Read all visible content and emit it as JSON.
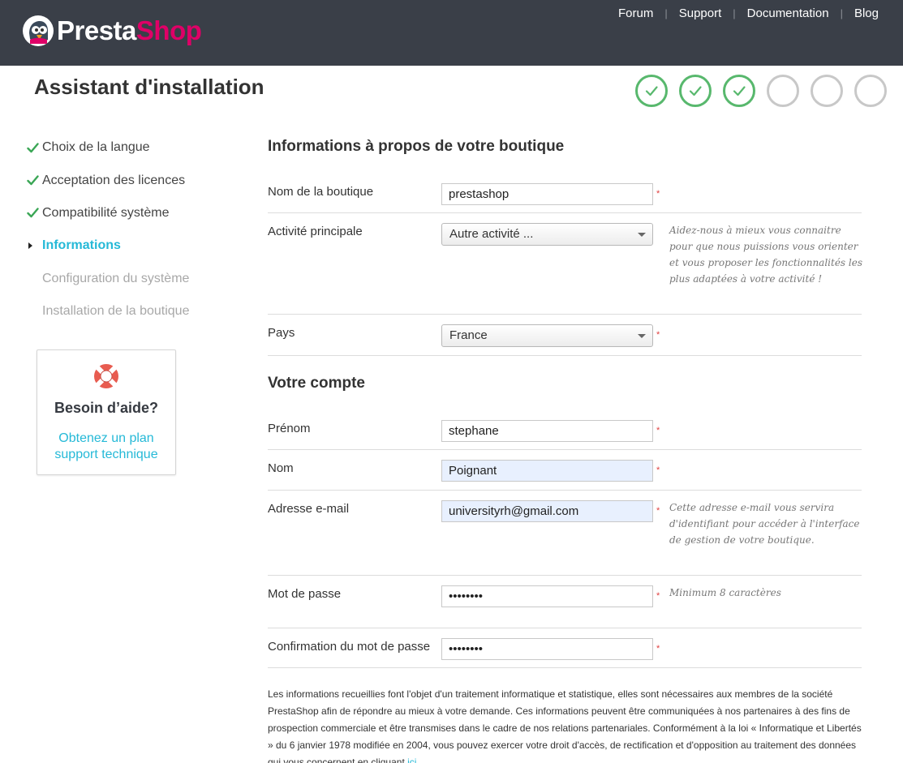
{
  "header": {
    "logo_part1": "Presta",
    "logo_part2": "Shop",
    "nav": [
      "Forum",
      "Support",
      "Documentation",
      "Blog"
    ]
  },
  "title": "Assistant d'installation",
  "steps": [
    {
      "state": "done"
    },
    {
      "state": "done"
    },
    {
      "state": "done"
    },
    {
      "state": "todo"
    },
    {
      "state": "todo"
    },
    {
      "state": "todo"
    }
  ],
  "sidebar": {
    "items": [
      {
        "label": "Choix de la langue",
        "state": "done"
      },
      {
        "label": "Acceptation des licences",
        "state": "done"
      },
      {
        "label": "Compatibilité système",
        "state": "done"
      },
      {
        "label": "Informations",
        "state": "active"
      },
      {
        "label": "Configuration du système",
        "state": "todo"
      },
      {
        "label": "Installation de la boutique",
        "state": "todo"
      }
    ]
  },
  "help": {
    "title": "Besoin d’aide?",
    "link_line1": "Obtenez un plan",
    "link_line2": "support technique"
  },
  "shop_section": {
    "title": "Informations à propos de votre boutique",
    "shop_name": {
      "label": "Nom de la boutique",
      "value": "prestashop"
    },
    "activity": {
      "label": "Activité principale",
      "value": "Autre activité ...",
      "hint": "Aidez-nous à mieux vous connaitre pour que nous puissions vous orienter et vous proposer les fonctionnalités les plus adaptées à votre activité !"
    },
    "country": {
      "label": "Pays",
      "value": "France"
    }
  },
  "account_section": {
    "title": "Votre compte",
    "firstname": {
      "label": "Prénom",
      "value": "stephane"
    },
    "lastname": {
      "label": "Nom",
      "value": "Poignant"
    },
    "email": {
      "label": "Adresse e-mail",
      "value": "universityrh@gmail.com",
      "hint": "Cette adresse e-mail vous servira d'identifiant pour accéder à l'interface de gestion de votre boutique."
    },
    "password": {
      "label": "Mot de passe",
      "value": "••••••••",
      "hint": "Minimum 8 caractères"
    },
    "password_confirm": {
      "label": "Confirmation du mot de passe",
      "value": "••••••••"
    }
  },
  "required_mark": "*",
  "legal": {
    "text": "Les informations recueillies font l'objet d'un traitement informatique et statistique, elles sont nécessaires aux membres de la société PrestaShop afin de répondre au mieux à votre demande. Ces informations peuvent être communiquées à nos partenaires à des fins de prospection commerciale et être transmises dans le cadre de nos relations partenariales. Conformément à la loi « Informatique et Libertés » du 6 janvier 1978 modifiée en 2004, vous pouvez exercer votre droit d'accès, de rectification et d'opposition au traitement des données qui vous concernent en cliquant ",
    "link": "ici"
  },
  "colors": {
    "header_bg": "#3a3f48",
    "brand_pink": "#df0067",
    "accent_blue": "#25b9d7",
    "success_green": "#58b86d"
  }
}
